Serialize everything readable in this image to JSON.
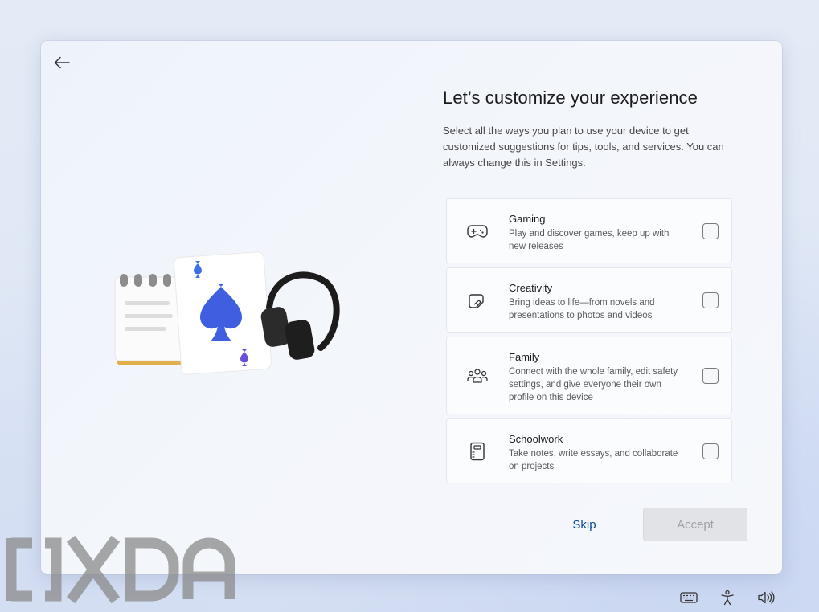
{
  "header": {
    "title": "Let’s customize your experience",
    "description": "Select all the ways you plan to use your device to get customized suggestions for tips, tools, and services. You can always change this in Settings."
  },
  "options": [
    {
      "title": "Gaming",
      "description": "Play and discover games, keep up with new releases",
      "icon": "gamepad-icon",
      "checked": false
    },
    {
      "title": "Creativity",
      "description": "Bring ideas to life—from novels and presentations to photos and videos",
      "icon": "creativity-icon",
      "checked": false
    },
    {
      "title": "Family",
      "description": "Connect with the whole family, edit safety settings, and give everyone their own profile on this device",
      "icon": "family-icon",
      "checked": false
    },
    {
      "title": "Schoolwork",
      "description": "Take notes, write essays, and collaborate on projects",
      "icon": "notebook-icon",
      "checked": false
    }
  ],
  "actions": {
    "skip_label": "Skip",
    "accept_label": "Accept"
  },
  "watermark": {
    "text": "XDA"
  },
  "tray_icons": [
    "keyboard-icon",
    "accessibility-icon",
    "volume-icon"
  ],
  "colors": {
    "accent": "#0a4a94",
    "spade": "#3f5fe0",
    "accept_disabled_bg": "#e1e3e7"
  }
}
